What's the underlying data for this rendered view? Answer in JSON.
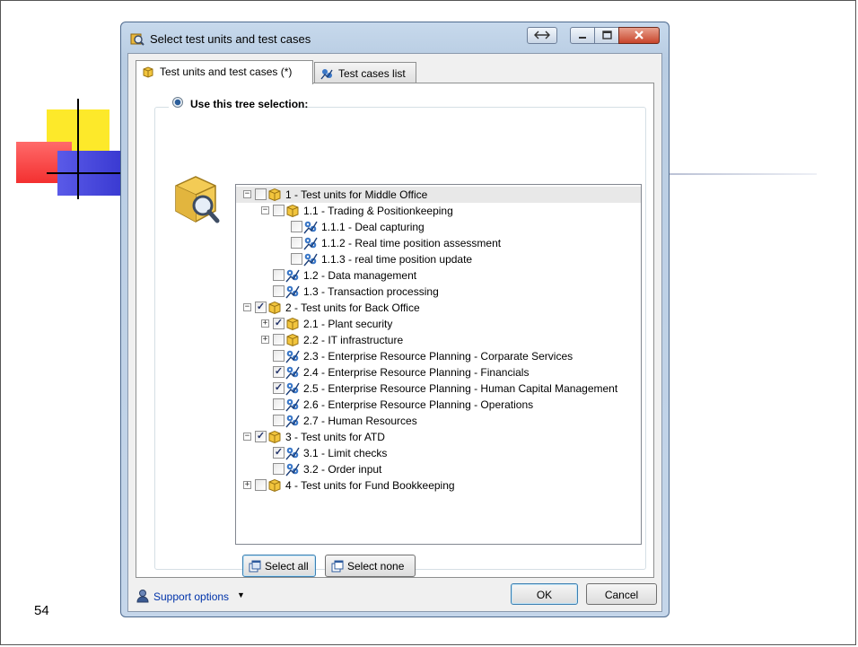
{
  "slide": {
    "page_number": "54"
  },
  "dialog": {
    "title": "Select test units and test cases",
    "tabs": [
      {
        "label": "Test units and test cases (*)",
        "icon": "box-icon",
        "active": true
      },
      {
        "label": "Test cases list",
        "icon": "gear-people-icon",
        "active": false
      }
    ],
    "radio_label": "Use this tree selection:",
    "tree": [
      {
        "label": "1 - Test units for Middle Office",
        "level": 0,
        "type": "unit",
        "expander": "minus",
        "checked": false,
        "selected": true
      },
      {
        "label": "1.1 - Trading & Positionkeeping",
        "level": 1,
        "type": "unit",
        "expander": "minus",
        "checked": false
      },
      {
        "label": "1.1.1 - Deal capturing",
        "level": 2,
        "type": "case",
        "expander": "",
        "checked": false
      },
      {
        "label": "1.1.2 - Real time position assessment",
        "level": 2,
        "type": "case",
        "expander": "",
        "checked": false
      },
      {
        "label": "1.1.3 - real time position update",
        "level": 2,
        "type": "case",
        "expander": "",
        "checked": false
      },
      {
        "label": "1.2 - Data management",
        "level": 1,
        "type": "case",
        "expander": "",
        "checked": false
      },
      {
        "label": "1.3 - Transaction processing",
        "level": 1,
        "type": "case",
        "expander": "",
        "checked": false
      },
      {
        "label": "2 - Test units for Back Office",
        "level": 0,
        "type": "unit",
        "expander": "minus",
        "checked": true
      },
      {
        "label": "2.1 - Plant security",
        "level": 1,
        "type": "unit",
        "expander": "plus",
        "checked": true
      },
      {
        "label": "2.2 - IT infrastructure",
        "level": 1,
        "type": "unit",
        "expander": "plus",
        "checked": false
      },
      {
        "label": "2.3 - Enterprise Resource Planning - Corparate Services",
        "level": 1,
        "type": "case",
        "expander": "",
        "checked": false
      },
      {
        "label": "2.4 - Enterprise Resource Planning - Financials",
        "level": 1,
        "type": "case",
        "expander": "",
        "checked": true
      },
      {
        "label": "2.5 - Enterprise Resource Planning - Human Capital Management",
        "level": 1,
        "type": "case",
        "expander": "",
        "checked": true
      },
      {
        "label": "2.6 - Enterprise Resource Planning - Operations",
        "level": 1,
        "type": "case",
        "expander": "",
        "checked": false
      },
      {
        "label": "2.7 - Human Resources",
        "level": 1,
        "type": "case",
        "expander": "",
        "checked": false
      },
      {
        "label": "3 - Test units for ATD",
        "level": 0,
        "type": "unit",
        "expander": "minus",
        "checked": true
      },
      {
        "label": "3.1 - Limit checks",
        "level": 1,
        "type": "case",
        "expander": "",
        "checked": true
      },
      {
        "label": "3.2 - Order input",
        "level": 1,
        "type": "case",
        "expander": "",
        "checked": false
      },
      {
        "label": "4 - Test units for Fund Bookkeeping",
        "level": 0,
        "type": "unit",
        "expander": "plus",
        "checked": false
      }
    ],
    "buttons": {
      "select_all": "Select all",
      "select_none": "Select none",
      "ok": "OK",
      "cancel": "Cancel"
    },
    "support_label": "Support options",
    "colors": {
      "accent": "#2a5d9a",
      "link": "#0033aa",
      "frame": "#c7d9ec"
    }
  }
}
